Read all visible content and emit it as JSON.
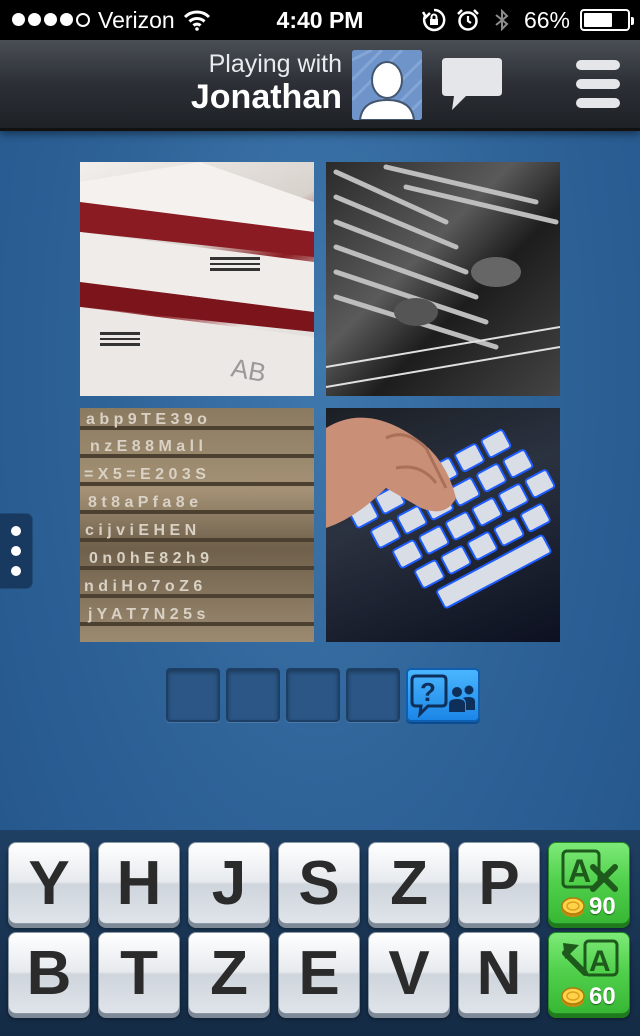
{
  "status_bar": {
    "carrier": "Verizon",
    "signal_bars": 4,
    "signal_max": 5,
    "time": "4:40 PM",
    "battery": "66%",
    "battery_level": 0.66
  },
  "header": {
    "playing_with_label": "Playing with",
    "opponent_name": "Jonathan",
    "avatar_icon": "person-silhouette-icon",
    "chat_icon": "speech-bubble-icon",
    "menu_icon": "hamburger-menu-icon"
  },
  "puzzle": {
    "images": [
      {
        "subject": "blood-bags-photo"
      },
      {
        "subject": "typewriter-typebars-photo"
      },
      {
        "subject": "letterpress-type-photo"
      },
      {
        "subject": "backlit-keyboard-photo"
      }
    ],
    "answer_slots": [
      "",
      "",
      "",
      ""
    ],
    "ask_friends_icon": "question-bubble-with-friends-icon"
  },
  "keyboard": {
    "row1": [
      "Y",
      "H",
      "J",
      "S",
      "Z",
      "P"
    ],
    "row2": [
      "B",
      "T",
      "Z",
      "E",
      "V",
      "N"
    ],
    "remove_letters": {
      "icon": "remove-letters-icon",
      "cost": "90"
    },
    "reveal_letter": {
      "icon": "reveal-letter-icon",
      "cost": "60"
    }
  },
  "colors": {
    "background": "#2f6499",
    "power_up_green": "#4fcf4a",
    "ask_button_blue": "#1b86e6"
  }
}
